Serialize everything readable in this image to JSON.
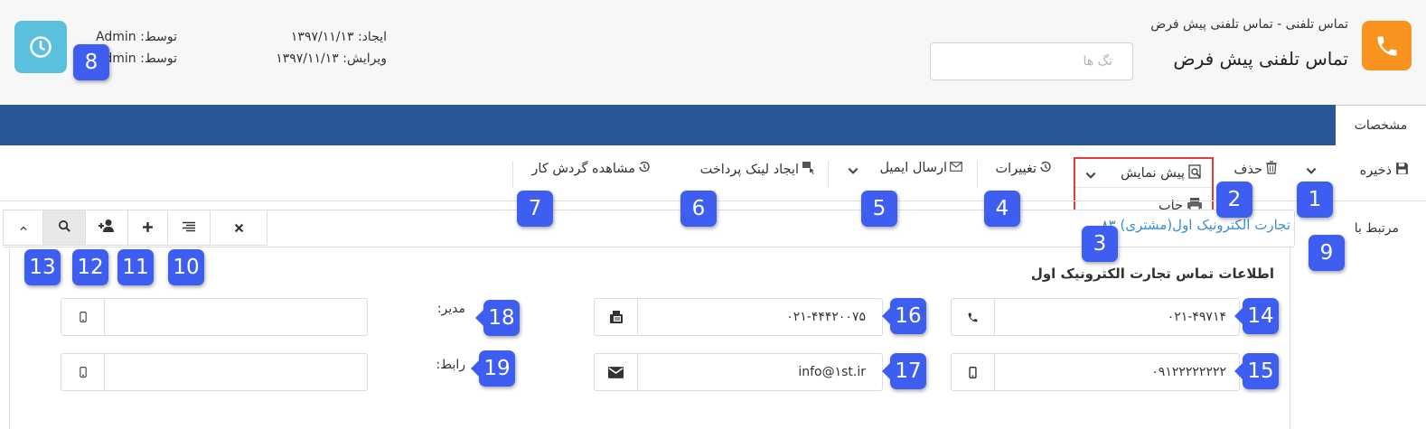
{
  "header": {
    "breadcrumb": "تماس تلفنی -  تماس تلفنی پیش فرض",
    "title": "تماس تلفنی پیش فرض",
    "tag_placeholder": "تگ ها",
    "created_label": "ایجاد: ۱۳۹۷/۱۱/۱۳",
    "edited_label": "ویرایش: ۱۳۹۷/۱۱/۱۳",
    "created_by": "توسط: Admin",
    "edited_by": "توسط: Admin",
    "app_icon": "phone-icon",
    "history_icon": "clock-icon",
    "colors": {
      "app_icon": "#f7931e",
      "history_icon": "#5bc0de",
      "nav_bar": "#2a5699",
      "badge": "#3d5ef0",
      "highlight": "#e03c3c"
    }
  },
  "tabs": {
    "active": "مشخصات"
  },
  "toolbar": {
    "save": "ذخیره",
    "delete": "حذف",
    "preview": "پیش نمایش",
    "changes": "تغییرات",
    "send_email": "ارسال ایمیل",
    "create_payment_link": "ایجاد لینک پرداخت",
    "view_workflow": "مشاهده گردش کار"
  },
  "preview_menu": {
    "print": "چاپ"
  },
  "related": {
    "label": "مرتبط با",
    "value": "تجارت الکترونیک اول(مشتری) ۸۳",
    "buttons": [
      "close-icon",
      "list-icon",
      "plus-icon",
      "add-contact-icon",
      "search-icon",
      "chevron-up-icon"
    ]
  },
  "contact_section": {
    "title": "اطلاعات تماس تجارت الکترونیک اول",
    "phone": "۰۲۱-۴۹۷۱۴",
    "mobile": "۰۹۱۲۲۲۲۲۲۲۲",
    "fax": "۰۲۱-۴۴۴۲۰۰۷۵",
    "email": "info@۱st.ir",
    "manager_label": "مدیر:",
    "manager_mobile": "",
    "liaison_label": "رابط:",
    "liaison_mobile": ""
  },
  "badges": [
    "1",
    "2",
    "3",
    "4",
    "5",
    "6",
    "7",
    "8",
    "9",
    "10",
    "11",
    "12",
    "13",
    "14",
    "15",
    "16",
    "17",
    "18",
    "19"
  ]
}
